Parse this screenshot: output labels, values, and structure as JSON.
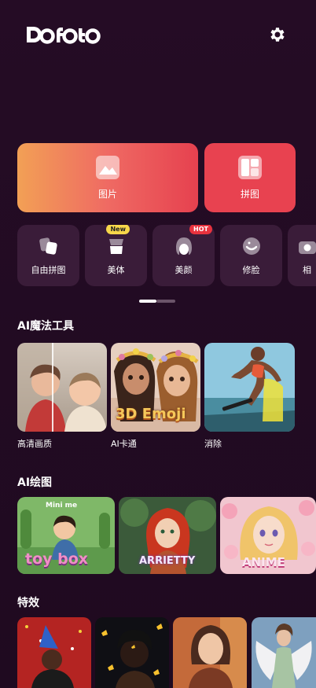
{
  "header": {
    "logo": "Dofoto",
    "settings_icon": "gear-icon"
  },
  "main_tiles": [
    {
      "label": "图片",
      "icon": "image-icon"
    },
    {
      "label": "拼图",
      "icon": "collage-layout-icon"
    }
  ],
  "tools": [
    {
      "label": "自由拼图",
      "icon": "free-collage-icon"
    },
    {
      "label": "美体",
      "icon": "body-icon",
      "badge": "New"
    },
    {
      "label": "美颜",
      "icon": "face-beauty-icon",
      "badge": "HOT"
    },
    {
      "label": "修脸",
      "icon": "face-retouch-icon"
    },
    {
      "label": "相",
      "icon": "camera-icon"
    }
  ],
  "pager": {
    "active_page": 1,
    "page_count": 2
  },
  "ai_magic": {
    "title": "AI魔法工具",
    "items": [
      {
        "label": "高清画质"
      },
      {
        "label": "AI卡通",
        "overlay": "3D Emoji"
      },
      {
        "label": "消除"
      }
    ]
  },
  "ai_drawing": {
    "title": "AI绘图",
    "items": [
      {
        "top_text": "Mini me",
        "overlay": "toy box"
      },
      {
        "overlay": "ARRIETTY"
      },
      {
        "overlay": "ANIME"
      }
    ]
  },
  "effects": {
    "title": "特效"
  },
  "colors": {
    "background": "#250c25",
    "tile_gradient_start": "#f2a055",
    "tile_gradient_end": "#e6414f",
    "tool_bg": "#3a1c39",
    "badge_new": "#f7d64a",
    "badge_hot": "#e8323e"
  }
}
